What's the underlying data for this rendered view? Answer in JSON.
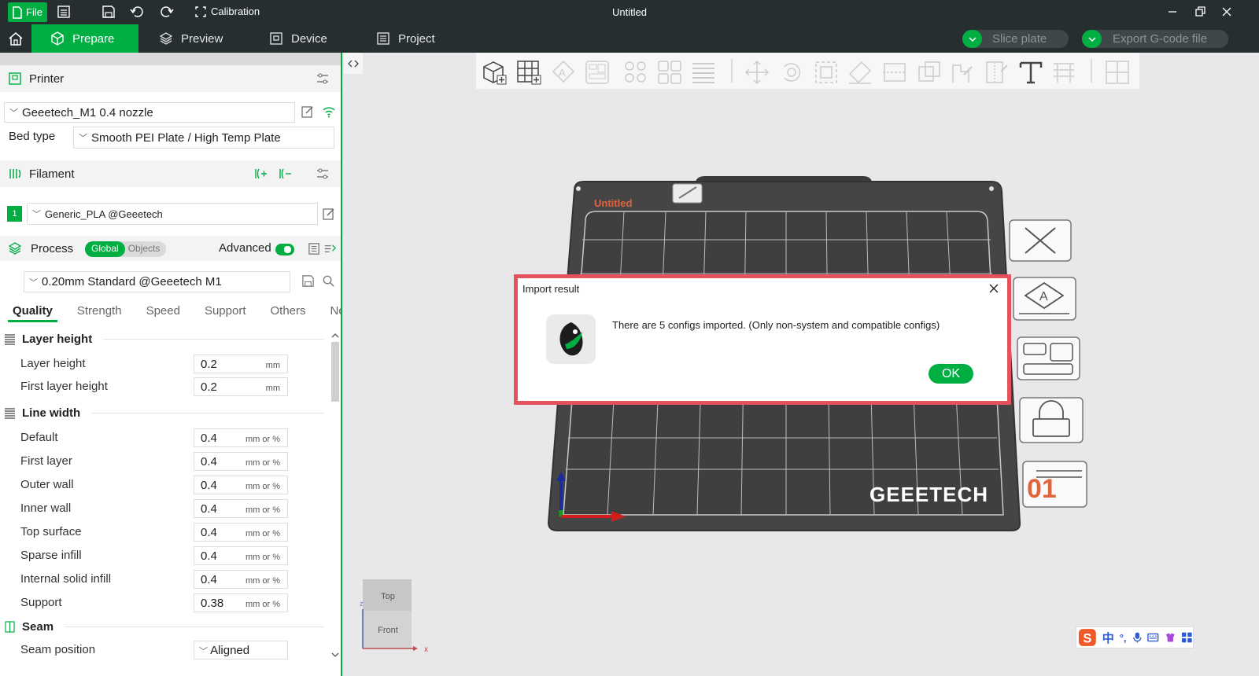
{
  "titlebar": {
    "file_label": "File",
    "calibration_label": "Calibration",
    "window_title": "Untitled"
  },
  "nav": {
    "tabs": [
      {
        "label": "Prepare",
        "active": true
      },
      {
        "label": "Preview",
        "active": false
      },
      {
        "label": "Device",
        "active": false
      },
      {
        "label": "Project",
        "active": false
      }
    ],
    "slice_label": "Slice plate",
    "export_label": "Export G-code file"
  },
  "printer": {
    "header": "Printer",
    "name": "Geeetech_M1 0.4 nozzle",
    "bed_type_label": "Bed type",
    "bed_type_value": "Smooth PEI Plate / High Temp Plate"
  },
  "filament": {
    "header": "Filament",
    "slot_number": "1",
    "slot_color": "#00ae42",
    "name": "Generic_PLA @Geeetech"
  },
  "process": {
    "header": "Process",
    "toggle_global": "Global",
    "toggle_objects": "Objects",
    "advanced_label": "Advanced",
    "advanced_on": true,
    "preset": "0.20mm Standard @Geeetech M1",
    "tabs": [
      "Quality",
      "Strength",
      "Speed",
      "Support",
      "Others",
      "Notes"
    ],
    "active_tab": "Quality",
    "groups": {
      "layer_height": {
        "title": "Layer height",
        "rows": [
          {
            "label": "Layer height",
            "value": "0.2",
            "unit": "mm"
          },
          {
            "label": "First layer height",
            "value": "0.2",
            "unit": "mm"
          }
        ]
      },
      "line_width": {
        "title": "Line width",
        "rows": [
          {
            "label": "Default",
            "value": "0.4",
            "unit": "mm or %"
          },
          {
            "label": "First layer",
            "value": "0.4",
            "unit": "mm or %"
          },
          {
            "label": "Outer wall",
            "value": "0.4",
            "unit": "mm or %"
          },
          {
            "label": "Inner wall",
            "value": "0.4",
            "unit": "mm or %"
          },
          {
            "label": "Top surface",
            "value": "0.4",
            "unit": "mm or %"
          },
          {
            "label": "Sparse infill",
            "value": "0.4",
            "unit": "mm or %"
          },
          {
            "label": "Internal solid infill",
            "value": "0.4",
            "unit": "mm or %"
          },
          {
            "label": "Support",
            "value": "0.38",
            "unit": "mm or %"
          }
        ]
      },
      "seam": {
        "title": "Seam",
        "position_label": "Seam position",
        "position_value": "Aligned"
      }
    }
  },
  "plate": {
    "name": "Untitled",
    "brand": "GEEETECH",
    "plate_number": "01"
  },
  "navcube": {
    "top": "Top",
    "front": "Front",
    "z": "z",
    "x": "x"
  },
  "dialog": {
    "title": "Import result",
    "message": "There are 5 configs imported. (Only non-system and compatible configs)",
    "ok_label": "OK"
  },
  "ime": {
    "zh": "中",
    "punct": "°,"
  },
  "colors": {
    "accent": "#00ae42",
    "dark": "#262e30",
    "dialog_border": "#e4525e",
    "plate_label": "#e0653f"
  }
}
